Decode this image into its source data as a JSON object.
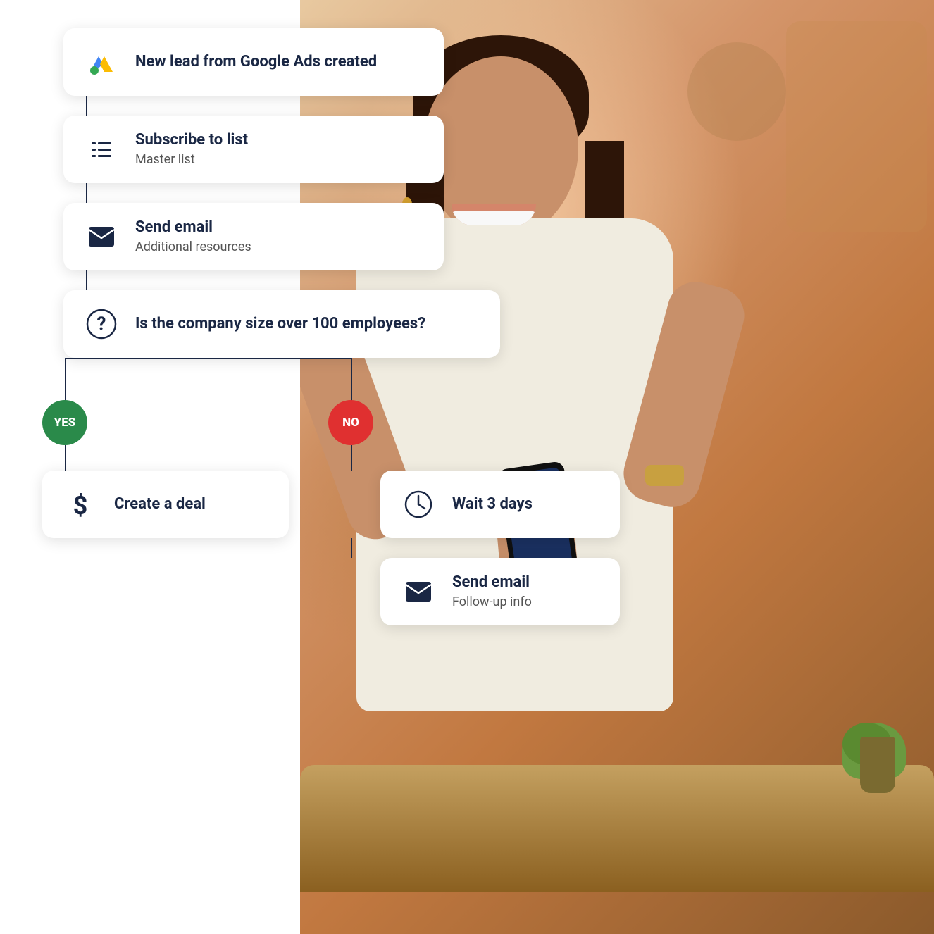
{
  "workflow": {
    "trigger": {
      "title": "New lead from Google Ads created",
      "icon": "google-ads-icon"
    },
    "step1": {
      "title": "Subscribe to list",
      "subtitle": "Master list",
      "icon": "list-icon"
    },
    "step2": {
      "title": "Send email",
      "subtitle": "Additional resources",
      "icon": "email-icon"
    },
    "condition": {
      "title": "Is the company size over 100 employees?",
      "icon": "question-icon"
    },
    "yes_label": "YES",
    "no_label": "NO",
    "yes_action": {
      "title": "Create a deal",
      "icon": "dollar-icon"
    },
    "no_action1": {
      "title": "Wait 3 days",
      "icon": "clock-icon"
    },
    "no_action2": {
      "title": "Send email",
      "subtitle": "Follow-up info",
      "icon": "email-icon"
    }
  }
}
